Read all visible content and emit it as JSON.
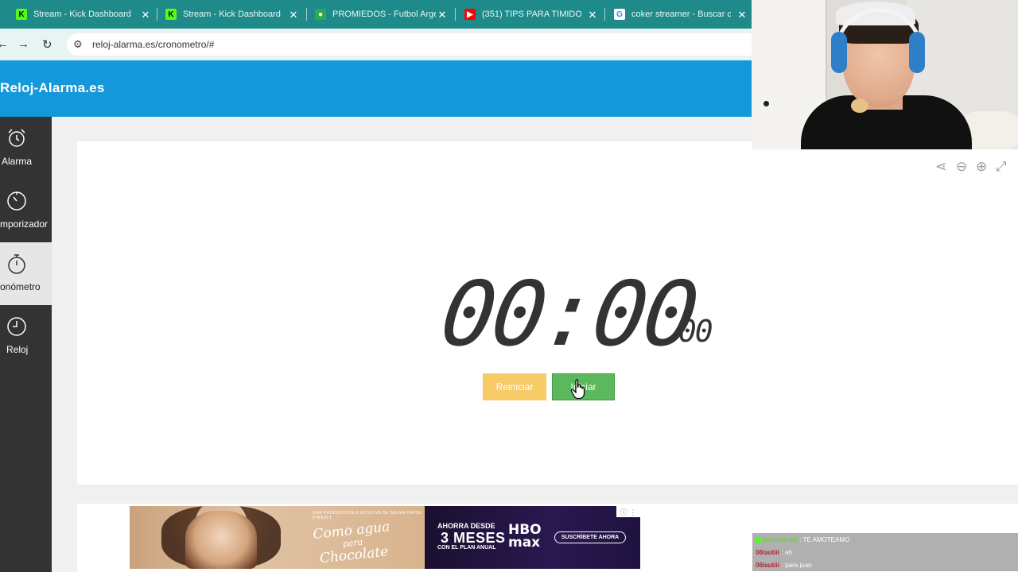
{
  "browser": {
    "tabs": [
      {
        "title": "Stream - Kick Dashboard",
        "favicon": "kick-icon"
      },
      {
        "title": "Stream - Kick Dashboard",
        "favicon": "kick-icon"
      },
      {
        "title": "PROMIEDOS - Futbol Arge",
        "favicon": "soccer-ball-icon"
      },
      {
        "title": "(351) TIPS PARA TÍMIDOS",
        "favicon": "youtube-icon"
      },
      {
        "title": "coker streamer - Buscar co",
        "favicon": "google-icon"
      }
    ],
    "url": "reloj-alarma.es/cronometro/#"
  },
  "site": {
    "brand": "Reloj-Alarma.es",
    "header_color": "#1498d9"
  },
  "sidebar": {
    "items": [
      {
        "label": "Alarma",
        "icon": "alarm-clock-icon",
        "active": false
      },
      {
        "label": "mporizador",
        "icon": "timer-icon",
        "active": false
      },
      {
        "label": "onómetro",
        "icon": "stopwatch-icon",
        "active": true
      },
      {
        "label": "Reloj",
        "icon": "clock-icon",
        "active": false
      }
    ]
  },
  "stopwatch": {
    "time": "00:00",
    "centiseconds": ".00",
    "reset_label": "Reiniciar",
    "start_label": "Iniciar",
    "reset_color": "#f7cb66",
    "start_color": "#5cb85c"
  },
  "toolbar": {
    "icons": [
      "share-icon",
      "zoom-out-icon",
      "zoom-in-icon",
      "fullscreen-icon"
    ]
  },
  "ad": {
    "tagline": "UNA PRODUCCIÓN EJECUTIVA DE SALMA HAYEK PINAULT",
    "movie_title_1": "Como agua",
    "movie_title_2": "para",
    "movie_title_3": "Chocolate",
    "offer_line1": "AHORRA DESDE",
    "offer_line2": "3 MESES",
    "offer_line3": "CON EL PLAN ANUAL",
    "logo_line1": "HBO",
    "logo_line2": "max",
    "cta": "SUSCRÍBETE AHORA"
  },
  "chat": {
    "messages": [
      {
        "user": "juanvaro16",
        "text": ": TE AMOTEAMO",
        "badge": true
      },
      {
        "user": "06lautiii",
        "text": ": eh",
        "badge": false
      },
      {
        "user": "06lautiii",
        "text": ": para juan",
        "badge": false
      }
    ]
  }
}
